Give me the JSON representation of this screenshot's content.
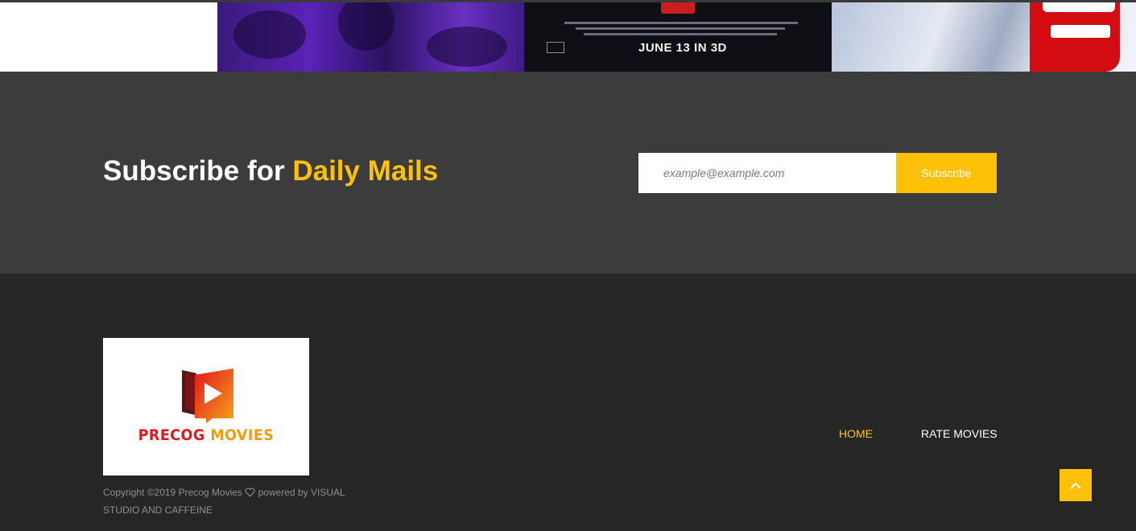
{
  "posters": {
    "middle_release_text": "JUNE 13 IN 3D"
  },
  "subscribe": {
    "title_prefix": "Subscribe for ",
    "title_accent": "Daily Mails",
    "email_placeholder": "example@example.com",
    "button_label": "Subscribe"
  },
  "footer": {
    "logo": {
      "word1": "PRECOG",
      "word2": "MOVIES"
    },
    "copyright_before_heart": "Copyright ©2019 Precog Movies",
    "copyright_after_heart": "powered by VISUAL STUDIO AND CAFFEINE",
    "nav": {
      "home": "HOME",
      "rate_movies": "RATE MOVIES"
    },
    "to_top_icon": "chevron-up-icon"
  },
  "colors": {
    "accent": "#ffc107",
    "subscribe_bg": "#3c3c3c",
    "footer_bg": "#262626"
  }
}
